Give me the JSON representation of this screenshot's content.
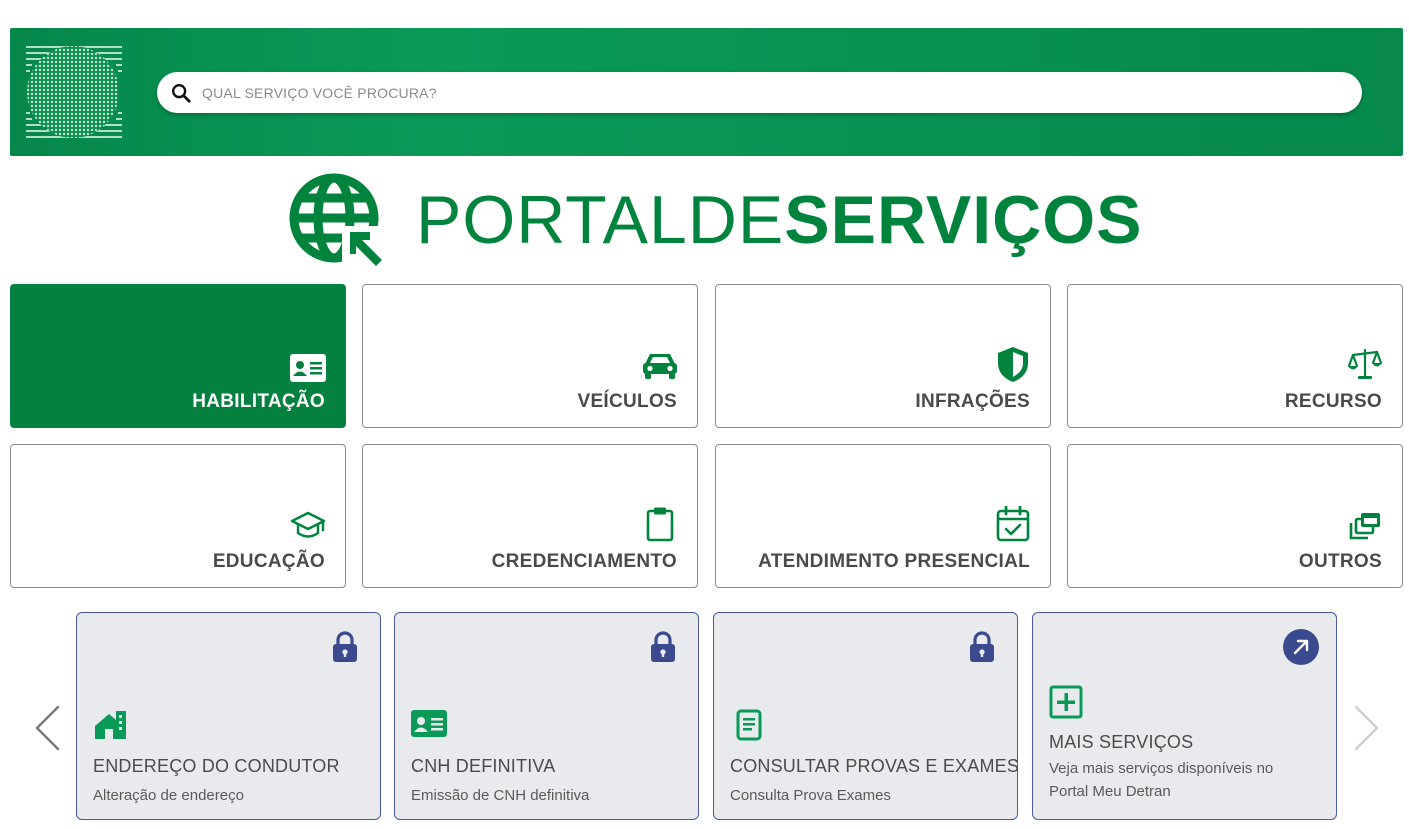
{
  "header": {
    "search": {
      "placeholder": "QUAL SERVIÇO VOCÊ PROCURA?",
      "value": ""
    }
  },
  "portal": {
    "title_light": "PORTALDE",
    "title_bold": "SERVIÇOS"
  },
  "categories": [
    {
      "label": "HABILITAÇÃO",
      "icon": "id-card-icon",
      "active": true
    },
    {
      "label": "VEÍCULOS",
      "icon": "car-icon",
      "active": false
    },
    {
      "label": "INFRAÇÕES",
      "icon": "shield-icon",
      "active": false
    },
    {
      "label": "RECURSO",
      "icon": "scales-icon",
      "active": false
    },
    {
      "label": "EDUCAÇÃO",
      "icon": "graduation-cap-icon",
      "active": false
    },
    {
      "label": "CREDENCIAMENTO",
      "icon": "clipboard-icon",
      "active": false
    },
    {
      "label": "ATENDIMENTO PRESENCIAL",
      "icon": "calendar-check-icon",
      "active": false
    },
    {
      "label": "OUTROS",
      "icon": "stacked-windows-icon",
      "active": false
    }
  ],
  "services": [
    {
      "title": "ENDEREÇO DO CONDUTOR",
      "description": "Alteração de endereço",
      "icon": "house-icon",
      "badge": "lock-icon"
    },
    {
      "title": "CNH DEFINITIVA",
      "description": "Emissão de CNH definitiva",
      "icon": "id-card-icon",
      "badge": "lock-icon"
    },
    {
      "title": "CONSULTAR PROVAS E EXAMES",
      "description": "Consulta Prova Exames",
      "icon": "document-icon",
      "badge": "lock-icon"
    },
    {
      "title": "MAIS SERVIÇOS",
      "description": "Veja mais serviços disponíveis no Portal Meu Detran",
      "icon": "plus-square-icon",
      "badge": "external-link-icon"
    }
  ],
  "colors": {
    "brand_green": "#00843d",
    "service_icon_green": "#0a9a58",
    "lock_blue": "#3b4a8f",
    "card_bg": "#e8eaed"
  }
}
